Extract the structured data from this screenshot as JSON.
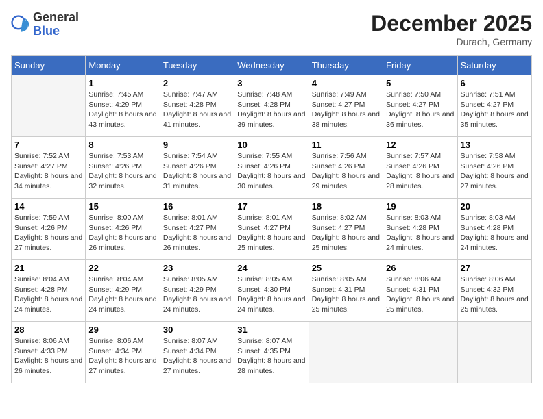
{
  "header": {
    "logo_general": "General",
    "logo_blue": "Blue",
    "month_title": "December 2025",
    "location": "Durach, Germany"
  },
  "weekdays": [
    "Sunday",
    "Monday",
    "Tuesday",
    "Wednesday",
    "Thursday",
    "Friday",
    "Saturday"
  ],
  "weeks": [
    [
      {
        "day": "",
        "empty": true
      },
      {
        "day": "1",
        "sunrise": "7:45 AM",
        "sunset": "4:29 PM",
        "daylight": "8 hours and 43 minutes."
      },
      {
        "day": "2",
        "sunrise": "7:47 AM",
        "sunset": "4:28 PM",
        "daylight": "8 hours and 41 minutes."
      },
      {
        "day": "3",
        "sunrise": "7:48 AM",
        "sunset": "4:28 PM",
        "daylight": "8 hours and 39 minutes."
      },
      {
        "day": "4",
        "sunrise": "7:49 AM",
        "sunset": "4:27 PM",
        "daylight": "8 hours and 38 minutes."
      },
      {
        "day": "5",
        "sunrise": "7:50 AM",
        "sunset": "4:27 PM",
        "daylight": "8 hours and 36 minutes."
      },
      {
        "day": "6",
        "sunrise": "7:51 AM",
        "sunset": "4:27 PM",
        "daylight": "8 hours and 35 minutes."
      }
    ],
    [
      {
        "day": "7",
        "sunrise": "7:52 AM",
        "sunset": "4:27 PM",
        "daylight": "8 hours and 34 minutes."
      },
      {
        "day": "8",
        "sunrise": "7:53 AM",
        "sunset": "4:26 PM",
        "daylight": "8 hours and 32 minutes."
      },
      {
        "day": "9",
        "sunrise": "7:54 AM",
        "sunset": "4:26 PM",
        "daylight": "8 hours and 31 minutes."
      },
      {
        "day": "10",
        "sunrise": "7:55 AM",
        "sunset": "4:26 PM",
        "daylight": "8 hours and 30 minutes."
      },
      {
        "day": "11",
        "sunrise": "7:56 AM",
        "sunset": "4:26 PM",
        "daylight": "8 hours and 29 minutes."
      },
      {
        "day": "12",
        "sunrise": "7:57 AM",
        "sunset": "4:26 PM",
        "daylight": "8 hours and 28 minutes."
      },
      {
        "day": "13",
        "sunrise": "7:58 AM",
        "sunset": "4:26 PM",
        "daylight": "8 hours and 27 minutes."
      }
    ],
    [
      {
        "day": "14",
        "sunrise": "7:59 AM",
        "sunset": "4:26 PM",
        "daylight": "8 hours and 27 minutes."
      },
      {
        "day": "15",
        "sunrise": "8:00 AM",
        "sunset": "4:26 PM",
        "daylight": "8 hours and 26 minutes."
      },
      {
        "day": "16",
        "sunrise": "8:01 AM",
        "sunset": "4:27 PM",
        "daylight": "8 hours and 26 minutes."
      },
      {
        "day": "17",
        "sunrise": "8:01 AM",
        "sunset": "4:27 PM",
        "daylight": "8 hours and 25 minutes."
      },
      {
        "day": "18",
        "sunrise": "8:02 AM",
        "sunset": "4:27 PM",
        "daylight": "8 hours and 25 minutes."
      },
      {
        "day": "19",
        "sunrise": "8:03 AM",
        "sunset": "4:28 PM",
        "daylight": "8 hours and 24 minutes."
      },
      {
        "day": "20",
        "sunrise": "8:03 AM",
        "sunset": "4:28 PM",
        "daylight": "8 hours and 24 minutes."
      }
    ],
    [
      {
        "day": "21",
        "sunrise": "8:04 AM",
        "sunset": "4:28 PM",
        "daylight": "8 hours and 24 minutes."
      },
      {
        "day": "22",
        "sunrise": "8:04 AM",
        "sunset": "4:29 PM",
        "daylight": "8 hours and 24 minutes."
      },
      {
        "day": "23",
        "sunrise": "8:05 AM",
        "sunset": "4:29 PM",
        "daylight": "8 hours and 24 minutes."
      },
      {
        "day": "24",
        "sunrise": "8:05 AM",
        "sunset": "4:30 PM",
        "daylight": "8 hours and 24 minutes."
      },
      {
        "day": "25",
        "sunrise": "8:05 AM",
        "sunset": "4:31 PM",
        "daylight": "8 hours and 25 minutes."
      },
      {
        "day": "26",
        "sunrise": "8:06 AM",
        "sunset": "4:31 PM",
        "daylight": "8 hours and 25 minutes."
      },
      {
        "day": "27",
        "sunrise": "8:06 AM",
        "sunset": "4:32 PM",
        "daylight": "8 hours and 25 minutes."
      }
    ],
    [
      {
        "day": "28",
        "sunrise": "8:06 AM",
        "sunset": "4:33 PM",
        "daylight": "8 hours and 26 minutes."
      },
      {
        "day": "29",
        "sunrise": "8:06 AM",
        "sunset": "4:34 PM",
        "daylight": "8 hours and 27 minutes."
      },
      {
        "day": "30",
        "sunrise": "8:07 AM",
        "sunset": "4:34 PM",
        "daylight": "8 hours and 27 minutes."
      },
      {
        "day": "31",
        "sunrise": "8:07 AM",
        "sunset": "4:35 PM",
        "daylight": "8 hours and 28 minutes."
      },
      {
        "day": "",
        "empty": true
      },
      {
        "day": "",
        "empty": true
      },
      {
        "day": "",
        "empty": true
      }
    ]
  ],
  "labels": {
    "sunrise": "Sunrise:",
    "sunset": "Sunset:",
    "daylight": "Daylight:"
  }
}
